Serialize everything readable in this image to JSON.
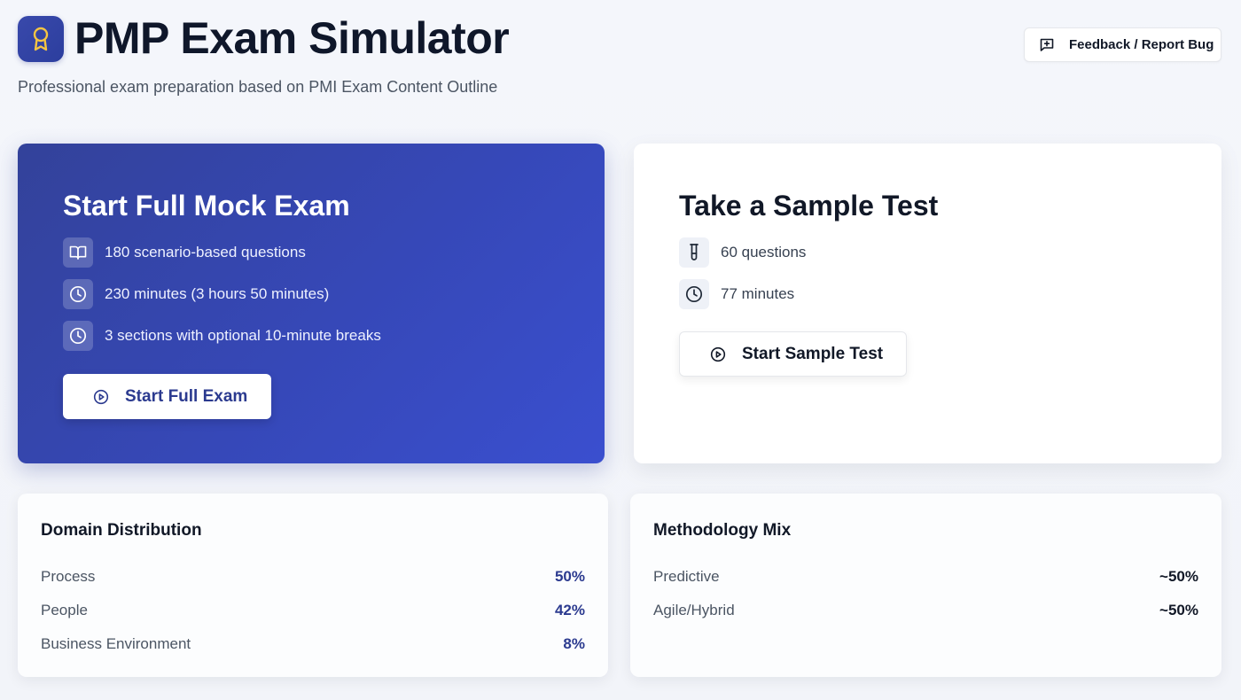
{
  "header": {
    "title": "PMP Exam Simulator",
    "subtitle": "Professional exam preparation based on PMI Exam Content Outline",
    "feedback_label": "Feedback / Report Bug",
    "logo_icon": "award-icon"
  },
  "full_exam": {
    "title": "Start Full Mock Exam",
    "features": [
      {
        "icon": "book-icon",
        "text": "180 scenario-based questions"
      },
      {
        "icon": "clock-icon",
        "text": "230 minutes (3 hours 50 minutes)"
      },
      {
        "icon": "clock-icon",
        "text": "3 sections with optional 10-minute breaks"
      }
    ],
    "button_label": "Start Full Exam"
  },
  "sample_test": {
    "title": "Take a Sample Test",
    "features": [
      {
        "icon": "test-tube-icon",
        "text": "60 questions"
      },
      {
        "icon": "clock-icon",
        "text": "77 minutes"
      }
    ],
    "button_label": "Start Sample Test"
  },
  "domain_distribution": {
    "title": "Domain Distribution",
    "rows": [
      {
        "label": "Process",
        "value": "50%"
      },
      {
        "label": "People",
        "value": "42%"
      },
      {
        "label": "Business Environment",
        "value": "8%"
      }
    ]
  },
  "methodology_mix": {
    "title": "Methodology Mix",
    "rows": [
      {
        "label": "Predictive",
        "value": "~50%"
      },
      {
        "label": "Agile/Hybrid",
        "value": "~50%"
      }
    ]
  },
  "colors": {
    "primary": "#3648b8",
    "accent_text": "#2b3a8f",
    "logo_accent": "#f5c542"
  }
}
